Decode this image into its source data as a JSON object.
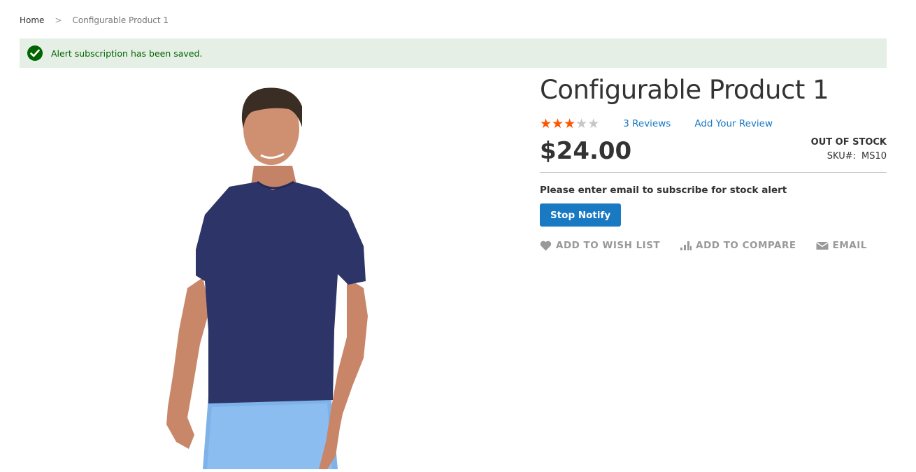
{
  "breadcrumbs": {
    "home": "Home",
    "separator": ">",
    "current": "Configurable Product 1"
  },
  "message": {
    "type": "success",
    "icon": "check-circle-icon",
    "text": "Alert subscription has been saved."
  },
  "product": {
    "title": "Configurable Product 1",
    "rating": {
      "value": 3,
      "max": 5
    },
    "reviews_link": "3 Reviews",
    "add_review_link": "Add Your Review",
    "price": "$24.00",
    "stock_status": "OUT OF STOCK",
    "sku_label": "SKU#:",
    "sku_value": "MS10",
    "image_alt": "Man wearing navy short-sleeve t-shirt and light blue shorts"
  },
  "stock_alert": {
    "label": "Please enter email to subscribe for stock alert",
    "button": "Stop Notify"
  },
  "actions": [
    {
      "label": "ADD TO WISH LIST",
      "icon": "heart-icon"
    },
    {
      "label": "ADD TO COMPARE",
      "icon": "compare-bars-icon"
    },
    {
      "label": "EMAIL",
      "icon": "envelope-icon"
    }
  ],
  "colors": {
    "link": "#1979c3",
    "button": "#1979c3",
    "star_active": "#ff5501",
    "star_inactive": "#c7c7c7",
    "success_bg": "#e5efe5",
    "success_text": "#006400"
  }
}
